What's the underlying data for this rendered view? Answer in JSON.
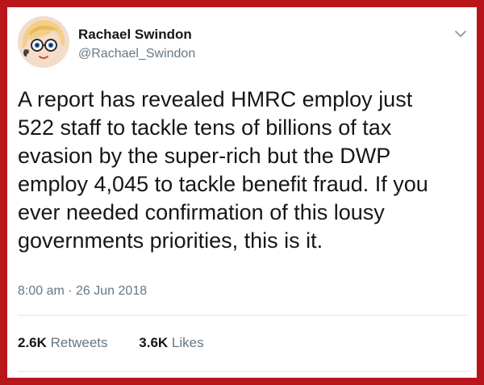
{
  "tweet": {
    "display_name": "Rachael Swindon",
    "handle": "@Rachael_Swindon",
    "text_lines": [
      "A report has revealed HMRC employ just",
      "522 staff to tackle tens of billions of tax",
      "evasion by the super-rich but the DWP",
      "employ 4,045 to tackle benefit fraud. If you",
      "ever needed confirmation of this lousy",
      "governments priorities, this is it."
    ],
    "timestamp": "8:00 am · 26 Jun 2018",
    "stats": {
      "retweets_count": "2.6K",
      "retweets_label": "Retweets",
      "likes_count": "3.6K",
      "likes_label": "Likes"
    }
  },
  "icons": {
    "avatar": "cartoon-avatar",
    "menu": "chevron-down-icon"
  },
  "colors": {
    "frame": "#b8161b",
    "text": "#14171a",
    "secondary": "#657786",
    "divider": "#e1e8ed"
  }
}
